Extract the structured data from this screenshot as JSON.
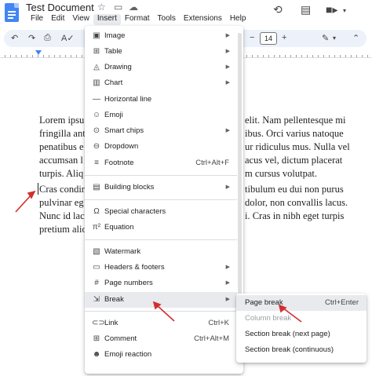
{
  "window": {
    "title": "Test Document"
  },
  "icons": {
    "star": "star-icon",
    "folder": "folder-move-icon",
    "cloud": "cloud-status-icon",
    "history": "history-icon",
    "comment": "comment-icon",
    "meet": "meet-camera-icon"
  },
  "menubar": [
    "File",
    "Edit",
    "View",
    "Insert",
    "Format",
    "Tools",
    "Extensions",
    "Help"
  ],
  "toolbar": {
    "font_size": "14"
  },
  "document": {
    "p1": [
      "Lorem ipsu",
      "fringilla ant",
      "penatibus e",
      "accumsan l",
      "turpis. Aliq"
    ],
    "p1_right": [
      "elit. Nam pellentesque mi",
      "ibus. Orci varius natoque",
      "ur ridiculus mus. Nulla vel",
      "acus vel, dictum placerat",
      "m cursus volutpat."
    ],
    "p2": [
      "Cras condin",
      "pulvinar eg",
      "Nunc id lac",
      "pretium alio"
    ],
    "p2_right": [
      "tibulum eu dui non purus",
      "dolor, non convallis lacus.",
      "i. Cras in nibh eget turpis",
      ""
    ]
  },
  "insert_menu": {
    "items": [
      {
        "label": "Image",
        "icon": "image-icon",
        "arrow": true
      },
      {
        "label": "Table",
        "icon": "table-icon",
        "arrow": true
      },
      {
        "label": "Drawing",
        "icon": "drawing-icon",
        "arrow": true
      },
      {
        "label": "Chart",
        "icon": "chart-icon",
        "arrow": true
      },
      {
        "label": "Horizontal line",
        "icon": "horizontal-line-icon",
        "arrow": false
      },
      {
        "label": "Emoji",
        "icon": "emoji-icon",
        "arrow": false
      },
      {
        "label": "Smart chips",
        "icon": "smart-chips-icon",
        "arrow": true
      },
      {
        "label": "Dropdown",
        "icon": "dropdown-icon",
        "arrow": false
      },
      {
        "label": "Footnote",
        "icon": "footnote-icon",
        "shortcut": "Ctrl+Alt+F"
      },
      {
        "label": "Building blocks",
        "icon": "building-blocks-icon",
        "arrow": true
      },
      {
        "label": "Special characters",
        "icon": "omega-icon",
        "arrow": false
      },
      {
        "label": "Equation",
        "icon": "pi-icon",
        "arrow": false
      },
      {
        "label": "Watermark",
        "icon": "watermark-icon",
        "arrow": false
      },
      {
        "label": "Headers & footers",
        "icon": "headers-footers-icon",
        "arrow": true
      },
      {
        "label": "Page numbers",
        "icon": "hash-icon",
        "arrow": true
      },
      {
        "label": "Break",
        "icon": "break-icon",
        "arrow": true
      },
      {
        "label": "Link",
        "icon": "link-icon",
        "shortcut": "Ctrl+K"
      },
      {
        "label": "Comment",
        "icon": "add-comment-icon",
        "shortcut": "Ctrl+Alt+M"
      },
      {
        "label": "Emoji reaction",
        "icon": "emoji-reaction-icon",
        "arrow": false
      }
    ]
  },
  "break_submenu": {
    "items": [
      {
        "label": "Page break",
        "shortcut": "Ctrl+Enter",
        "enabled": true
      },
      {
        "label": "Column break",
        "shortcut": "",
        "enabled": false
      },
      {
        "label": "Section break (next page)",
        "shortcut": "",
        "enabled": true
      },
      {
        "label": "Section break (continuous)",
        "shortcut": "",
        "enabled": true
      }
    ]
  },
  "colors": {
    "accent": "#4285f4",
    "highlight": "#e8eaed",
    "annotation_arrow": "#d32f2f"
  }
}
